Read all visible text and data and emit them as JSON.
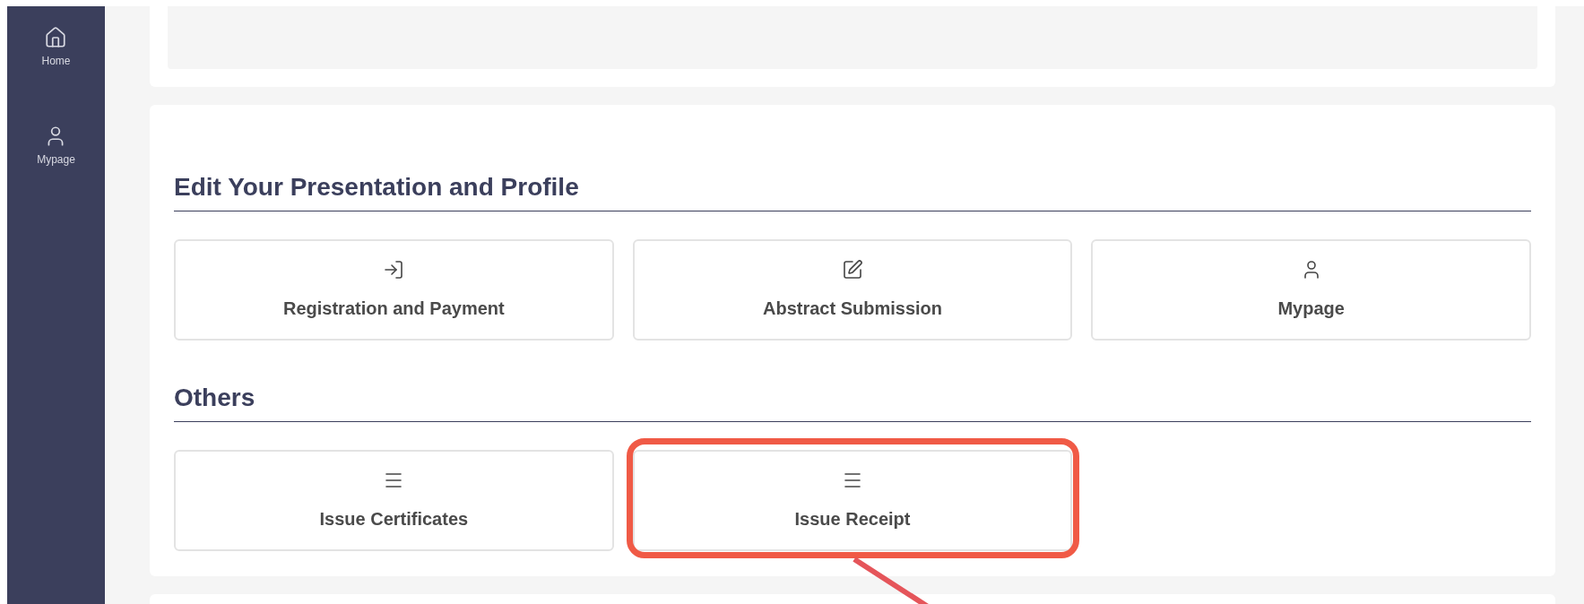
{
  "sidebar": {
    "items": [
      {
        "label": "Home",
        "kind": "home"
      },
      {
        "label": "Mypage",
        "kind": "user"
      }
    ]
  },
  "sections": [
    {
      "title": "Edit Your Presentation and Profile",
      "buttons": [
        {
          "label": "Registration and Payment",
          "kind": "login",
          "highlighted": false
        },
        {
          "label": "Abstract Submission",
          "kind": "edit",
          "highlighted": false
        },
        {
          "label": "Mypage",
          "kind": "user",
          "highlighted": false
        }
      ]
    },
    {
      "title": "Others",
      "buttons": [
        {
          "label": "Issue Certificates",
          "kind": "menu",
          "highlighted": false
        },
        {
          "label": "Issue Receipt",
          "kind": "menu",
          "highlighted": true
        }
      ]
    }
  ]
}
